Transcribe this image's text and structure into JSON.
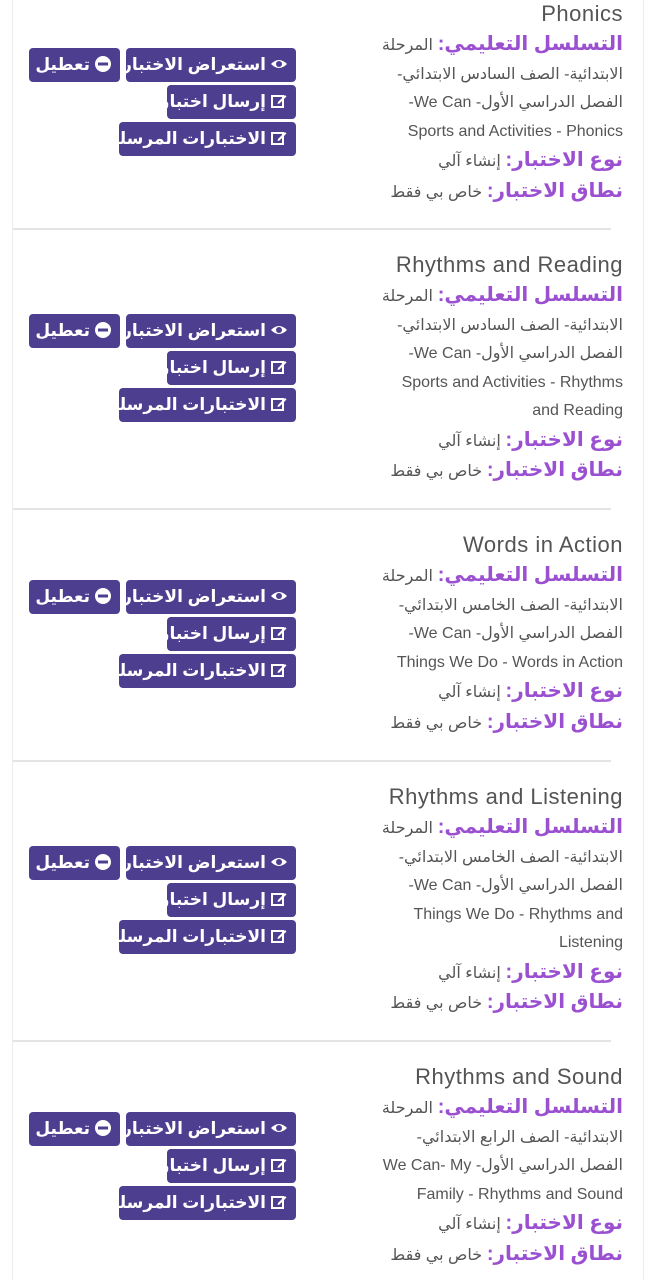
{
  "buttons": {
    "disable": "تعطيل",
    "preview": "استعراض الاختبار",
    "send": "إرسال اختبار",
    "sent": "الاختبارات المرسلة"
  },
  "labels": {
    "hierarchy": "التسلسل التعليمي:",
    "type": "نوع الاختبار:",
    "scope": "نطاق الاختبار:"
  },
  "exams": [
    {
      "title": "Phonics",
      "hierarchy_lines": [
        "المرحلة",
        "الابتدائية- الصف السادس الابتدائي-",
        "الفصل الدراسي الأول- We Can-",
        "Sports and Activities - Phonics"
      ],
      "type_value": "إنشاء آلي",
      "scope_value": "خاص بي فقط"
    },
    {
      "title": "Rhythms and Reading",
      "hierarchy_lines": [
        "المرحلة",
        "الابتدائية- الصف السادس الابتدائي-",
        "الفصل الدراسي الأول- We Can-",
        "Sports and Activities - Rhythms",
        "and Reading"
      ],
      "type_value": "إنشاء آلي",
      "scope_value": "خاص بي فقط"
    },
    {
      "title": "Words in Action",
      "hierarchy_lines": [
        "المرحلة",
        "الابتدائية- الصف الخامس الابتدائي-",
        "الفصل الدراسي الأول- We Can-",
        "Things We Do - Words in Action"
      ],
      "type_value": "إنشاء آلي",
      "scope_value": "خاص بي فقط"
    },
    {
      "title": "Rhythms and Listening",
      "hierarchy_lines": [
        "المرحلة",
        "الابتدائية- الصف الخامس الابتدائي-",
        "الفصل الدراسي الأول- We Can-",
        "Things We Do - Rhythms and",
        "Listening"
      ],
      "type_value": "إنشاء آلي",
      "scope_value": "خاص بي فقط"
    },
    {
      "title": "Rhythms and Sound",
      "hierarchy_lines": [
        "المرحلة",
        "الابتدائية- الصف الرابع الابتدائي-",
        "الفصل الدراسي الأول- We Can- My",
        "Family - Rhythms and Sound"
      ],
      "type_value": "إنشاء آلي",
      "scope_value": "خاص بي فقط"
    }
  ]
}
